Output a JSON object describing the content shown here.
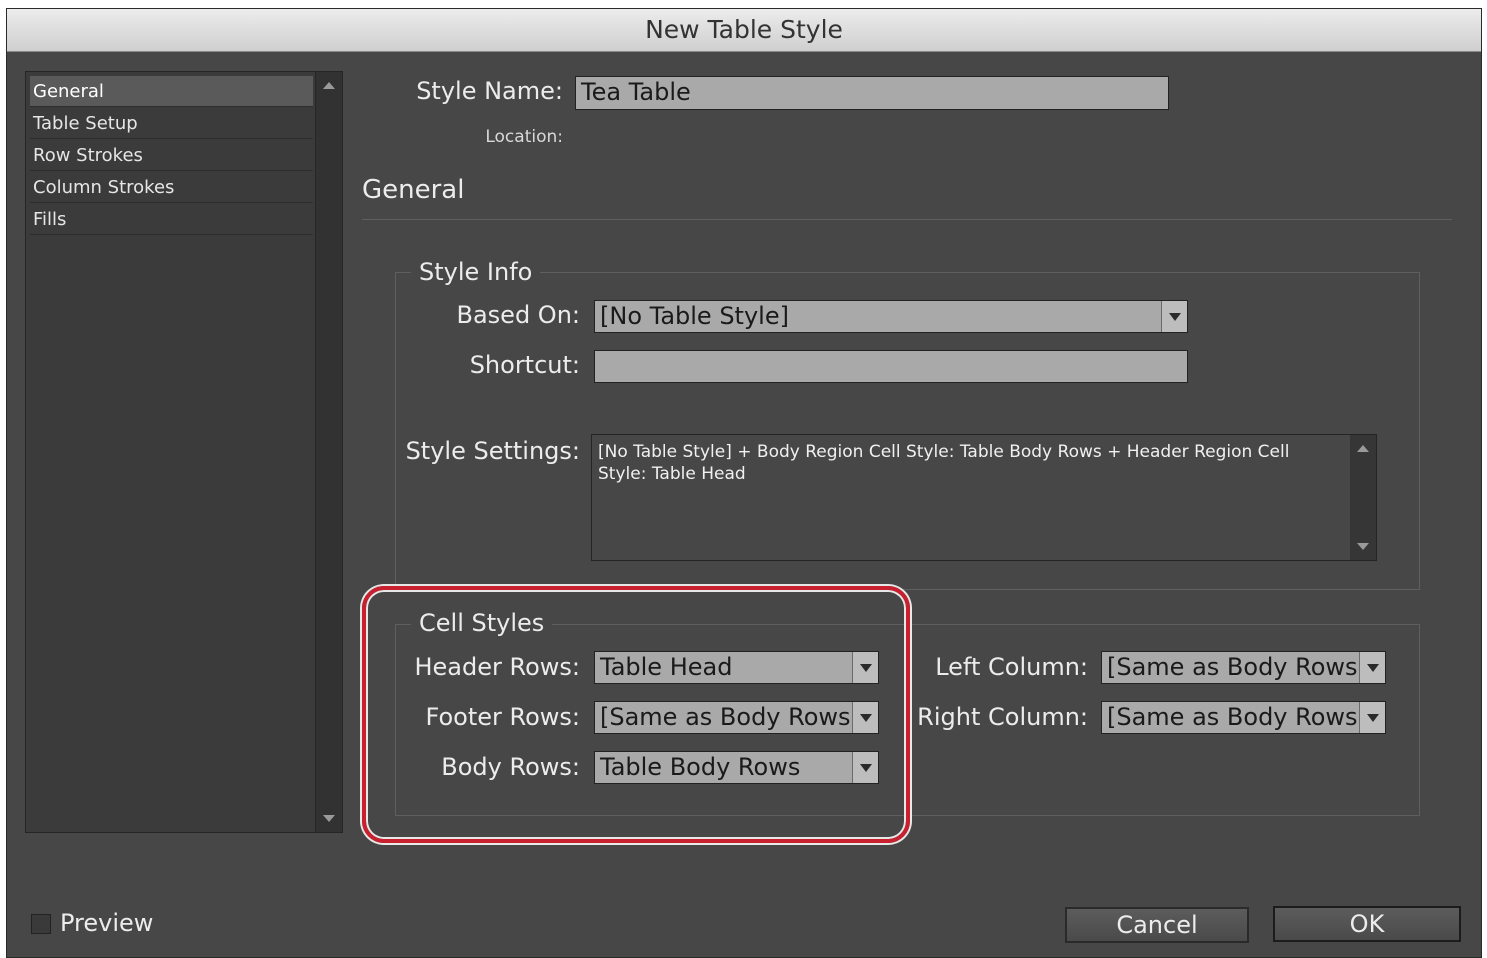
{
  "window": {
    "title": "New Table Style"
  },
  "sidebar": {
    "items": [
      {
        "label": "General",
        "selected": true
      },
      {
        "label": "Table Setup"
      },
      {
        "label": "Row Strokes"
      },
      {
        "label": "Column Strokes"
      },
      {
        "label": "Fills"
      }
    ]
  },
  "header": {
    "style_name_label": "Style Name:",
    "style_name_value": "Tea Table",
    "location_label": "Location:",
    "section_title": "General"
  },
  "style_info": {
    "legend": "Style Info",
    "based_on_label": "Based On:",
    "based_on_value": "[No Table Style]",
    "shortcut_label": "Shortcut:",
    "shortcut_value": "",
    "style_settings_label": "Style Settings:",
    "style_settings_text": "[No Table Style] + Body Region Cell Style: Table Body Rows + Header Region Cell Style: Table Head"
  },
  "cell_styles": {
    "legend": "Cell Styles",
    "header_rows_label": "Header Rows:",
    "header_rows_value": "Table Head",
    "footer_rows_label": "Footer Rows:",
    "footer_rows_value": "[Same as Body Rows]",
    "body_rows_label": "Body Rows:",
    "body_rows_value": "Table Body Rows",
    "left_column_label": "Left Column:",
    "left_column_value": "[Same as Body Rows]",
    "right_column_label": "Right Column:",
    "right_column_value": "[Same as Body Rows]"
  },
  "footer": {
    "preview_label": "Preview",
    "preview_checked": false,
    "cancel_label": "Cancel",
    "ok_label": "OK"
  },
  "colors": {
    "highlight": "#c8202f",
    "dialog_bg": "#474747"
  }
}
